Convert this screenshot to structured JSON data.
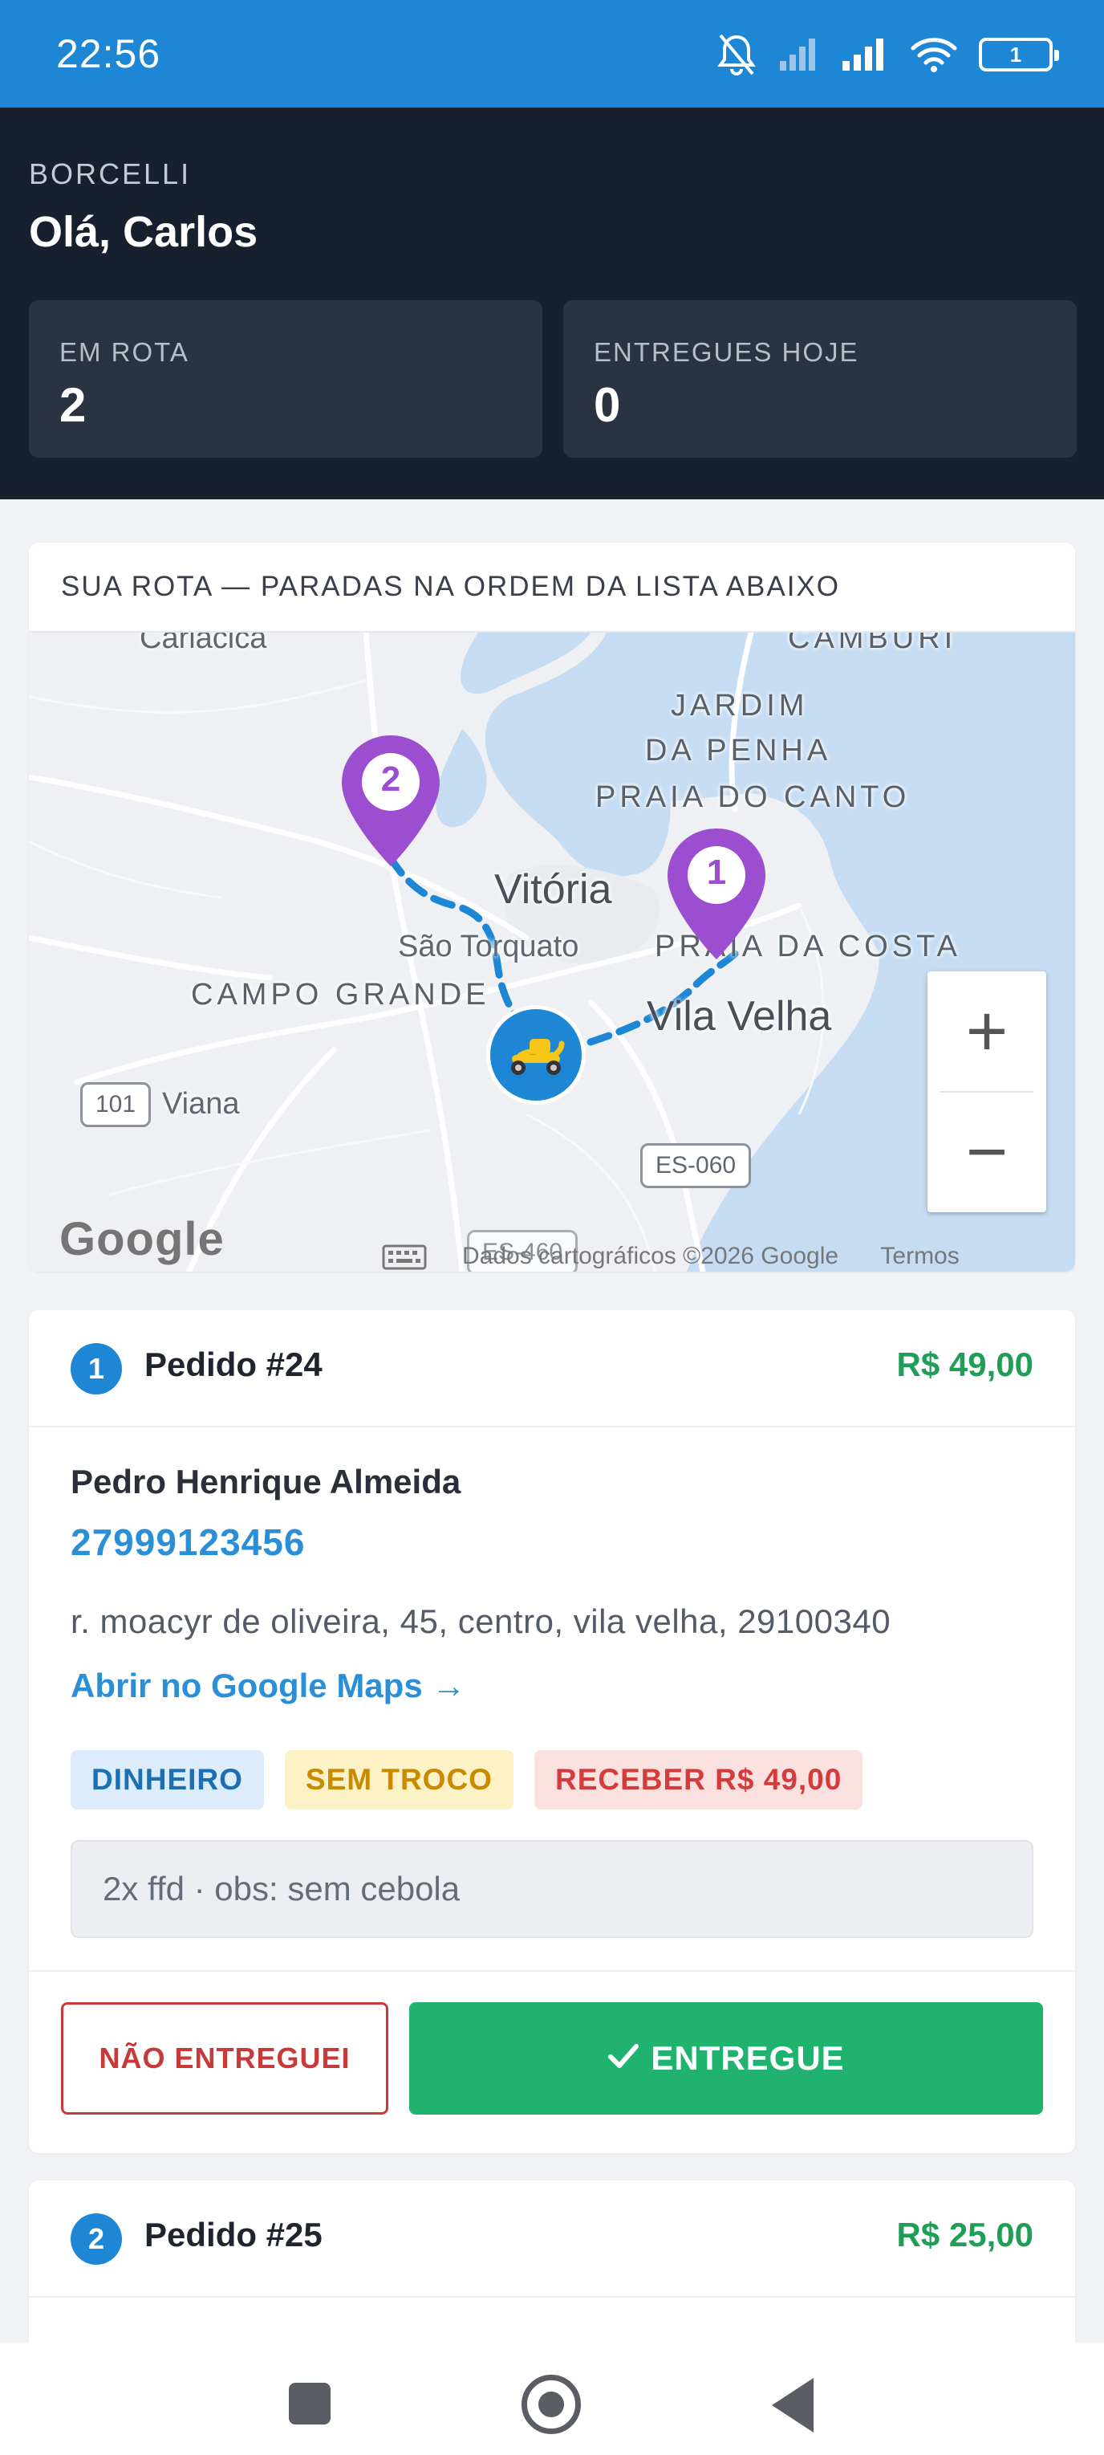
{
  "status_bar": {
    "time": "22:56",
    "battery": "1"
  },
  "header": {
    "brand": "BORCELLI",
    "greeting": "Olá, Carlos",
    "stats": [
      {
        "label": "EM ROTA",
        "value": "2"
      },
      {
        "label": "ENTREGUES HOJE",
        "value": "0"
      }
    ]
  },
  "map_card": {
    "title": "SUA ROTA — PARADAS NA ORDEM DA LISTA ABAIXO",
    "labels": {
      "cariacica": "Cariacica",
      "camburi": "CAMBURI",
      "jardim": "JARDIM",
      "da_penha": "DA PENHA",
      "praia_do_canto": "PRAIA DO CANTO",
      "vitoria": "Vitória",
      "sao_torquato": "São Torquato",
      "praia_da_costa": "PRAIA DA COSTA",
      "campo_grande": "CAMPO GRANDE",
      "vila_velha": "Vila Velha",
      "viana": "Viana",
      "shield_101": "101",
      "shield_es060": "ES-060",
      "shield_es460": "ES-460"
    },
    "pins": [
      "1",
      "2"
    ],
    "zoom_in": "+",
    "zoom_out": "−",
    "google_logo": "Google",
    "attribution": "Dados cartográficos ©2026 Google",
    "terms": "Termos"
  },
  "orders": [
    {
      "index": "1",
      "title": "Pedido #24",
      "price": "R$ 49,00",
      "customer": "Pedro Henrique Almeida",
      "phone": "27999123456",
      "address": "r. moacyr de oliveira, 45, centro, vila velha, 29100340",
      "maps_link": "Abrir no Google Maps →",
      "tags": [
        "DINHEIRO",
        "SEM TROCO",
        "RECEBER R$ 49,00"
      ],
      "notes": "2x ffd · obs: sem cebola",
      "btn_not_delivered": "NÃO ENTREGUEI",
      "btn_delivered": "ENTREGUE"
    },
    {
      "index": "2",
      "title": "Pedido #25",
      "price": "R$ 25,00"
    }
  ],
  "colors": {
    "accent": "#1d87d6",
    "header_bg": "#182030",
    "success": "#1fb36f",
    "danger": "#c83a3a",
    "pin": "#9b4fd0"
  }
}
